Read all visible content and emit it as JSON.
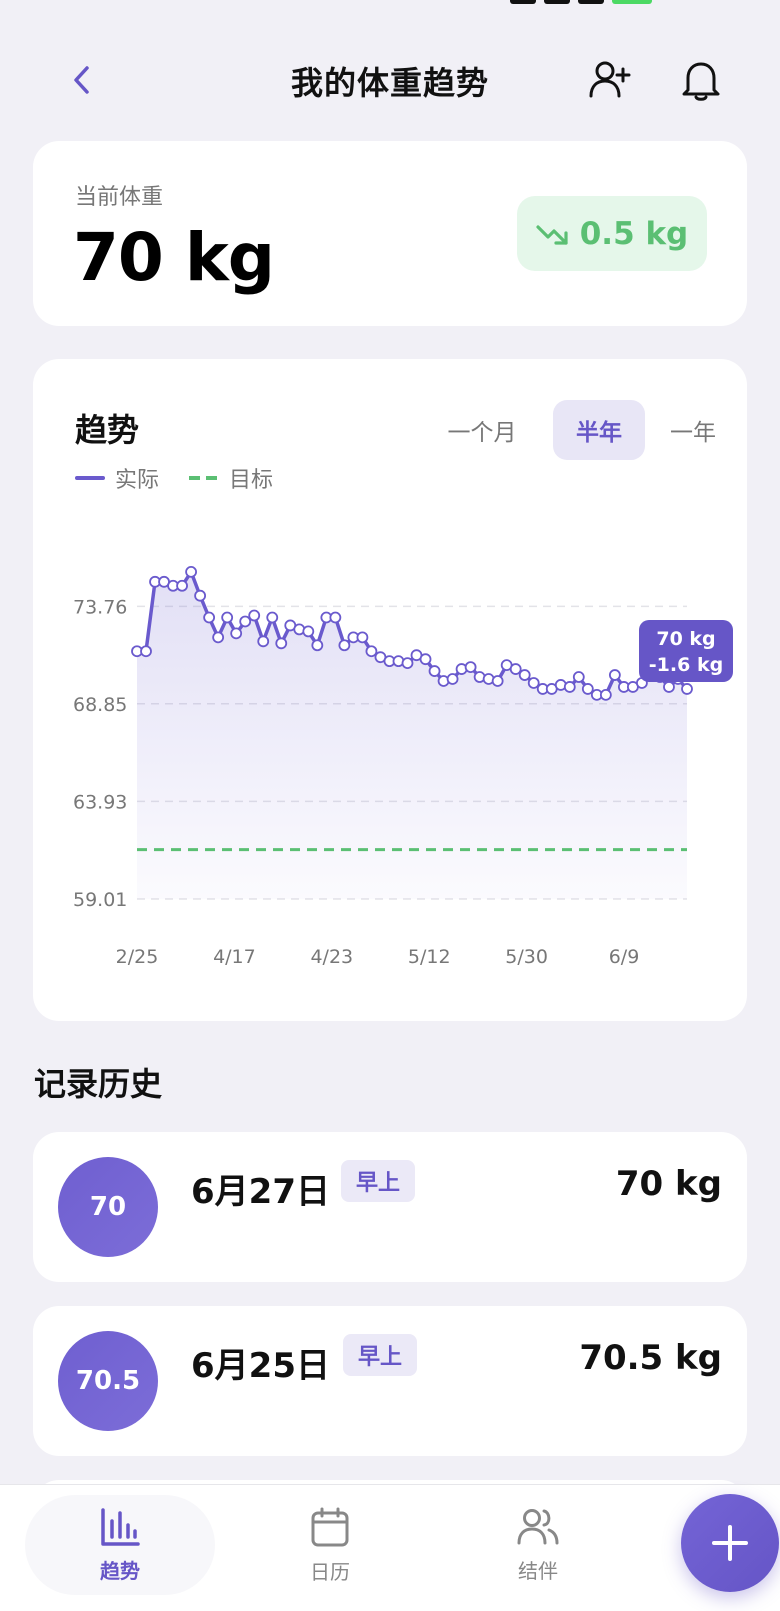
{
  "header": {
    "title": "我的体重趋势"
  },
  "current": {
    "label": "当前体重",
    "value": "70 kg",
    "change": "0.5 kg"
  },
  "trend": {
    "title": "趋势",
    "tabs": [
      "一个月",
      "半年",
      "一年"
    ],
    "active_tab": "半年",
    "legend_actual": "实际",
    "legend_goal": "目标",
    "tooltip_value": "70 kg",
    "tooltip_change": "-1.6 kg"
  },
  "chart_data": {
    "type": "line",
    "x_ticks": [
      "2/25",
      "4/17",
      "4/23",
      "5/12",
      "5/30",
      "6/9"
    ],
    "y_ticks": [
      "73.76",
      "68.85",
      "63.93",
      "59.01"
    ],
    "ylim": [
      59.01,
      78.67
    ],
    "goal": 61.5,
    "grid": true,
    "series": [
      {
        "name": "实际",
        "values": [
          71.5,
          71.5,
          75.0,
          75.0,
          74.8,
          74.8,
          75.5,
          74.3,
          73.2,
          72.2,
          73.2,
          72.4,
          73.0,
          73.3,
          72.0,
          73.2,
          71.9,
          72.8,
          72.6,
          72.5,
          71.8,
          73.2,
          73.2,
          71.8,
          72.2,
          72.2,
          71.5,
          71.2,
          71.0,
          71.0,
          70.9,
          71.3,
          71.1,
          70.5,
          70.0,
          70.1,
          70.6,
          70.7,
          70.2,
          70.1,
          70.0,
          70.8,
          70.6,
          70.3,
          69.9,
          69.6,
          69.6,
          69.8,
          69.7,
          70.2,
          69.6,
          69.3,
          69.3,
          70.3,
          69.7,
          69.7,
          69.9,
          70.5,
          70.2,
          69.7,
          70.1,
          69.6
        ]
      }
    ]
  },
  "history": {
    "title": "记录历史",
    "items": [
      {
        "avatar": "70",
        "date": "6月27日",
        "tag": "早上",
        "weight": "70 kg"
      },
      {
        "avatar": "70.5",
        "date": "6月25日",
        "tag": "早上",
        "weight": "70.5 kg"
      }
    ]
  },
  "nav": {
    "items": [
      "趋势",
      "日历",
      "结伴"
    ]
  },
  "colors": {
    "accent": "#6a5acd",
    "goal": "#5bbf73",
    "background": "#f1f0f6"
  }
}
